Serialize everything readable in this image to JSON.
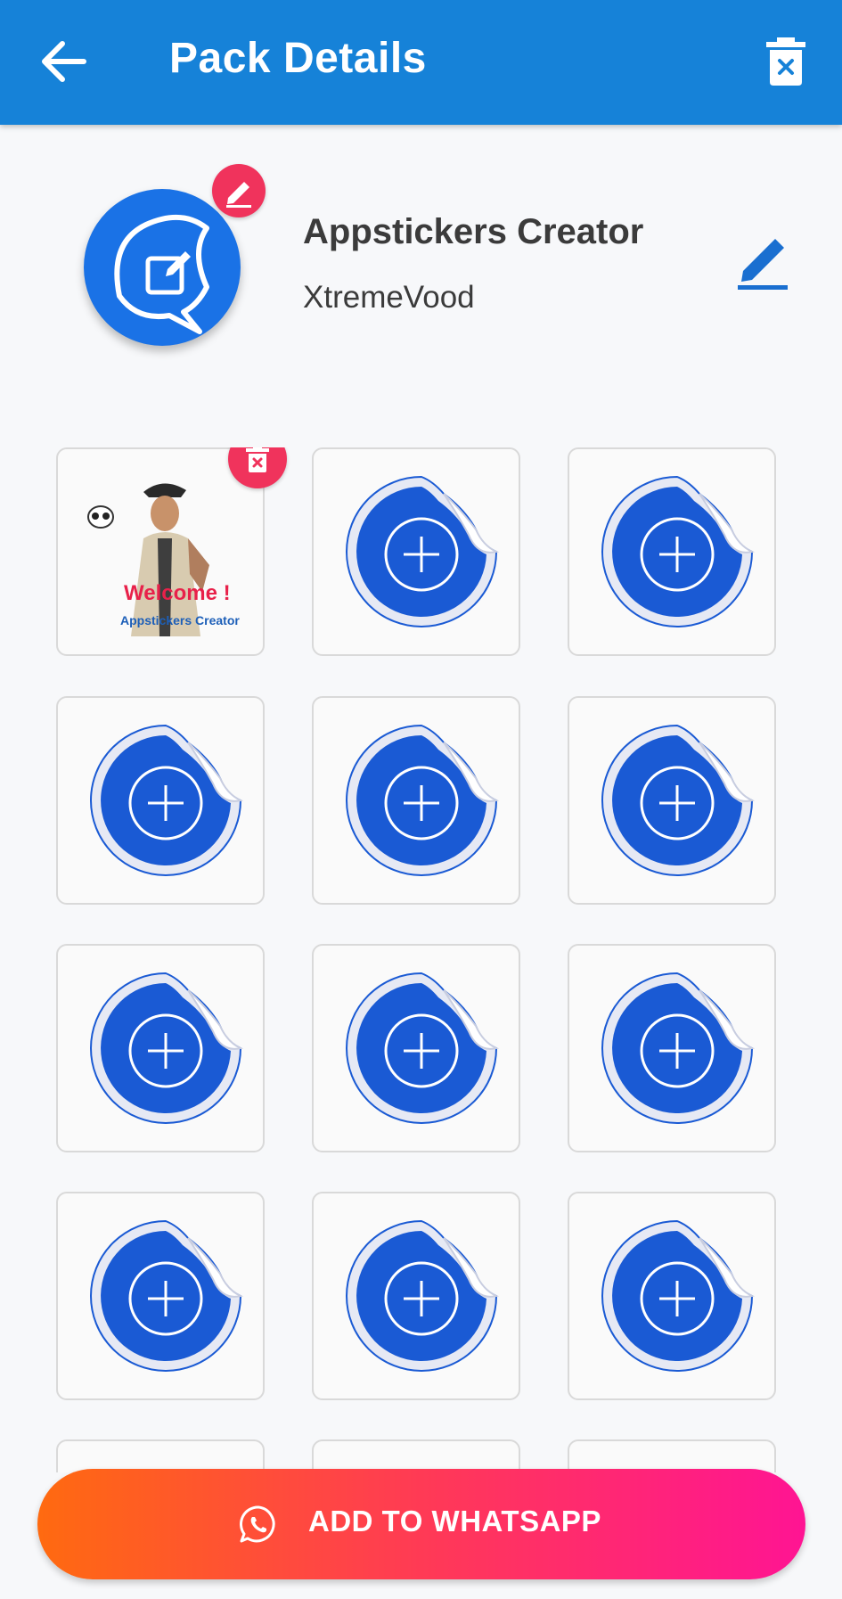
{
  "appbar": {
    "title": "Pack Details",
    "back_icon": "arrow-left-icon",
    "delete_icon": "trash-icon"
  },
  "pack": {
    "name": "Appstickers Creator",
    "author": "XtremeVood",
    "logo_icon": "sticker-edit-icon",
    "edit_logo_icon": "pencil-icon",
    "edit_info_icon": "pencil-icon"
  },
  "stickers": {
    "first": {
      "welcome_text": "Welcome !",
      "caption": "Appstickers Creator",
      "delete_icon": "trash-icon"
    },
    "placeholder_icon": "add-sticker-icon"
  },
  "cta": {
    "label": "ADD TO WHATSAPP",
    "icon": "whatsapp-icon"
  },
  "colors": {
    "appbar": "#1682d8",
    "accent_pink": "#f0335c",
    "sticker_blue": "#1a5ad4",
    "cta_start": "#ff6a10",
    "cta_end": "#ff1493"
  }
}
